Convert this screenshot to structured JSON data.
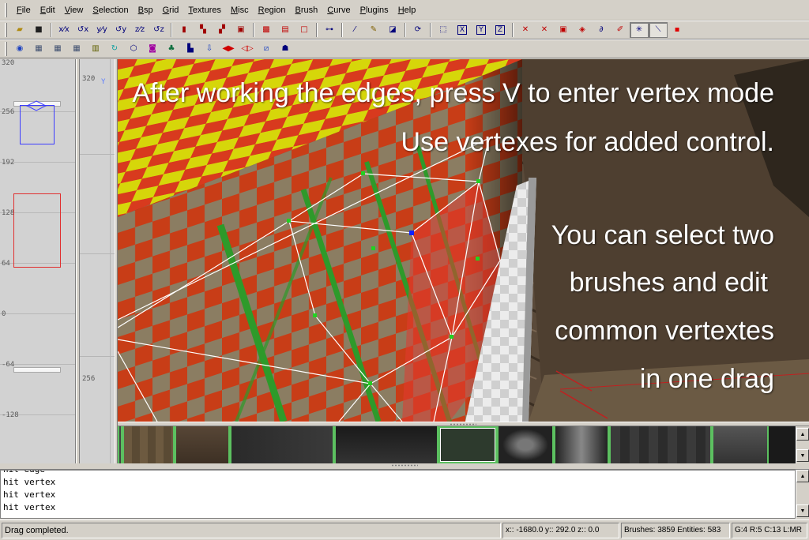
{
  "menubar": {
    "items": [
      "File",
      "Edit",
      "View",
      "Selection",
      "Bsp",
      "Grid",
      "Textures",
      "Misc",
      "Region",
      "Brush",
      "Curve",
      "Plugins",
      "Help"
    ]
  },
  "toolbar1": {
    "axis_buttons": [
      "X",
      "Y",
      "Z"
    ]
  },
  "zview": {
    "labels": [
      "320",
      "256",
      "192",
      "128",
      "64",
      "0",
      "-64",
      "-128"
    ]
  },
  "ortho_view": {
    "labels": [
      "320",
      "256"
    ],
    "axis_letter": "Y"
  },
  "camera": {
    "overlay_lines": [
      "After working the edges, press V to enter vertex mode",
      "Use vertexes for added control.",
      "You can select two",
      "brushes and edit",
      "common vertextes",
      "in one drag"
    ]
  },
  "console": {
    "lines": [
      "hit edge",
      "hit vertex",
      "hit vertex",
      "hit vertex"
    ]
  },
  "statusbar": {
    "message": "Drag completed.",
    "coords": "x:: -1680.0  y:: 292.0  z:: 0.0",
    "counts": "Brushes: 3859 Entities: 583",
    "grid_info": "G:4 R:5 C:13 L:MR"
  },
  "colors": {
    "chrome": "#d4d0c8",
    "grid_bg": "#d2d2d2",
    "texture_red": "#d83a1e",
    "texture_yellow": "#d6d60a",
    "texture_green": "#2e9a2a",
    "selection_white": "#ffffff",
    "vertex_green": "#22d122",
    "vertex_blue": "#1020ff"
  },
  "icons": [
    "open-folder-icon",
    "save-icon",
    "flip-x-icon",
    "flip-y-icon",
    "flip-z-icon",
    "rotate-x-icon",
    "rotate-y-icon",
    "rotate-z-icon",
    "select-tall-icon",
    "select-touching-icon",
    "select-partial-icon",
    "select-inside-icon",
    "csg-subtract-icon",
    "csg-merge-icon",
    "hollow-icon",
    "clipper-icon",
    "change-view-icon",
    "texture-lock-icon",
    "cubic-clip-icon",
    "camera-icon",
    "view-x-icon",
    "view-y-icon",
    "view-z-icon",
    "show-models-icon",
    "cube-toggle-icon",
    "patch-icon",
    "entity-icon",
    "lighting-icon",
    "vertex-mode-icon",
    "edge-mode-icon",
    "plugin-red-icon"
  ]
}
